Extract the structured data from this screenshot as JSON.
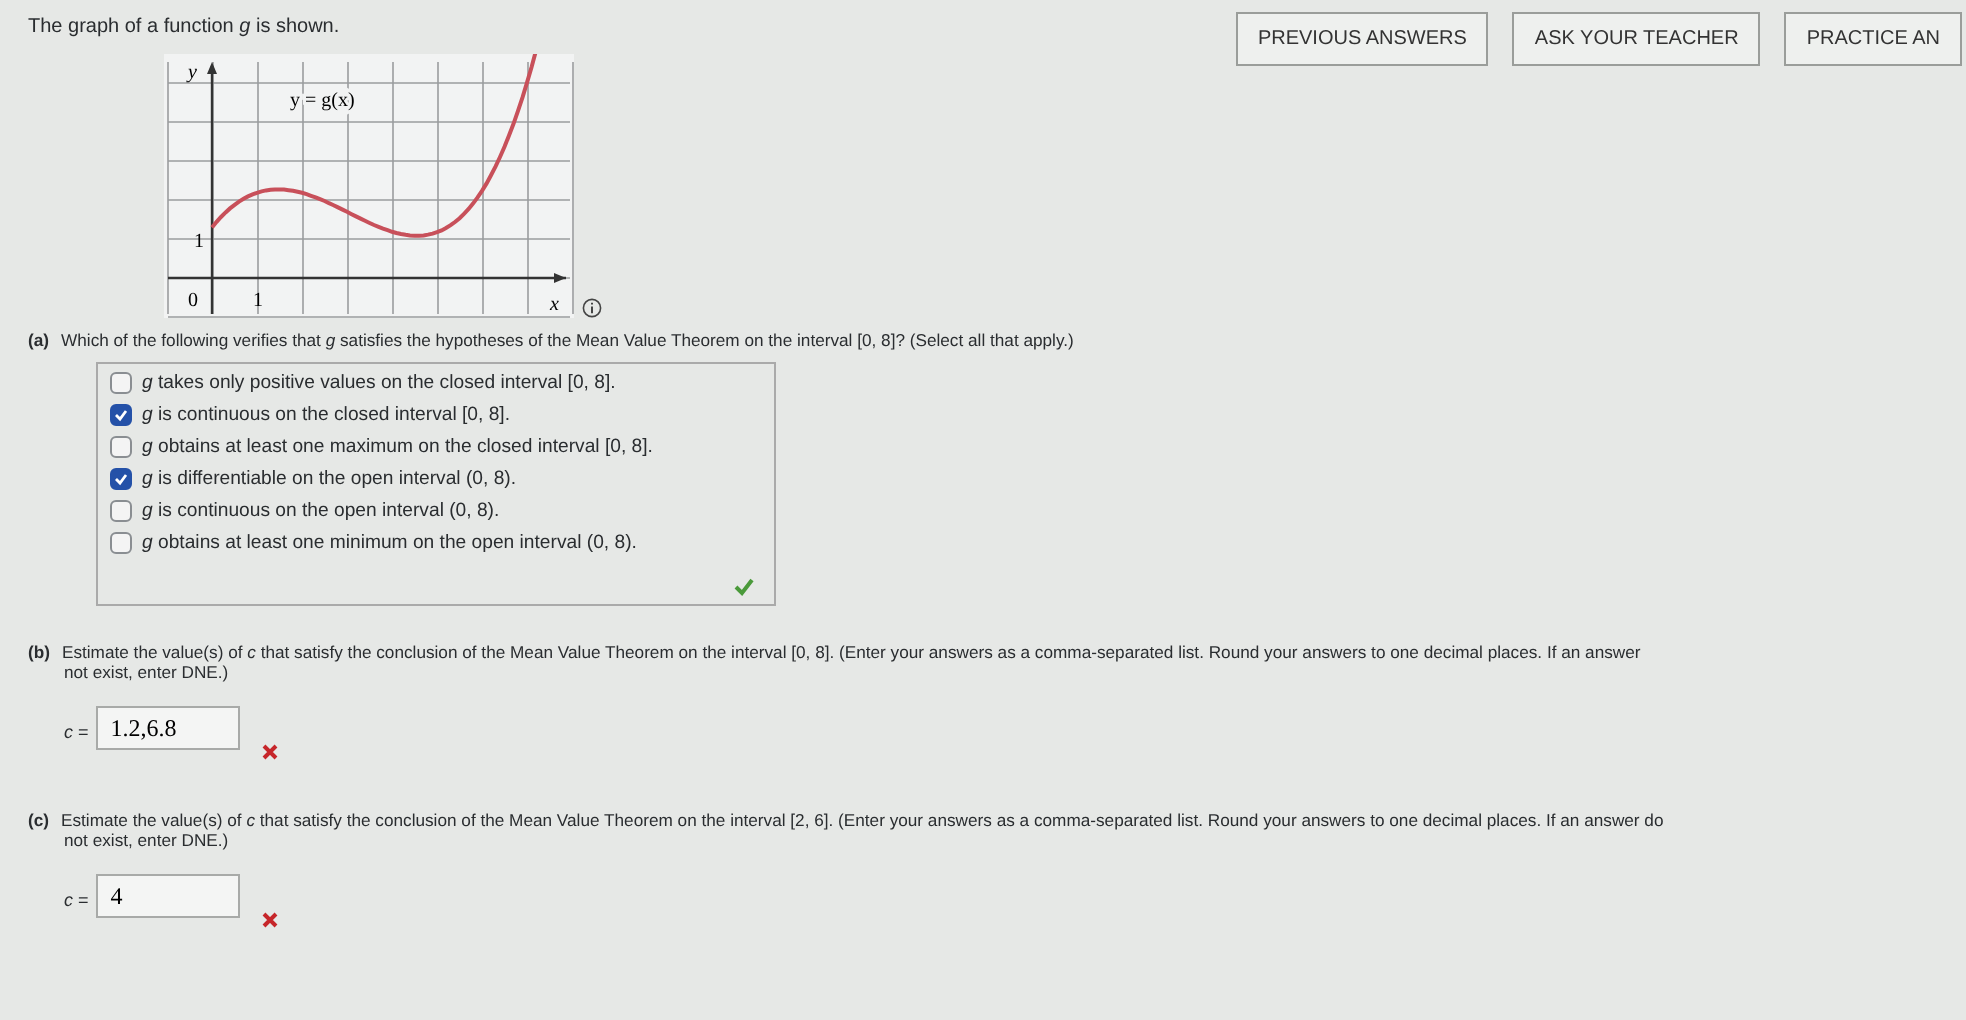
{
  "intro": "The graph of a function *g* is shown.",
  "buttons": [
    "PREVIOUS ANSWERS",
    "ASK YOUR TEACHER",
    "PRACTICE AN"
  ],
  "graph": {
    "y_axis_label": "y",
    "x_axis_label": "x",
    "origin_label": "0",
    "x_tick_label": "1",
    "y_tick_label": "1",
    "curve_label": "y = g(x)"
  },
  "part_a": {
    "letter": "(a)",
    "question": "Which of the following verifies that *g* satisfies the hypotheses of the Mean Value Theorem on the interval [0, 8]? (Select all that apply.)",
    "options": [
      {
        "text": "*g* takes only positive values on the closed interval [0, 8].",
        "checked": false
      },
      {
        "text": "*g* is continuous on the closed interval [0, 8].",
        "checked": true
      },
      {
        "text": "*g* obtains at least one maximum on the closed interval [0, 8].",
        "checked": false
      },
      {
        "text": "*g* is differentiable on the open interval (0, 8).",
        "checked": true
      },
      {
        "text": "*g* is continuous on the open interval (0, 8).",
        "checked": false
      },
      {
        "text": "*g* obtains at least one minimum on the open interval (0, 8).",
        "checked": false
      }
    ],
    "correct": true
  },
  "part_b": {
    "letter": "(b)",
    "prompt_line_1": "Estimate the value(s) of *c* that satisfy the conclusion of the Mean Value Theorem on the interval [0, 8]. (Enter your answers as a comma-separated list. Round your answers to one decimal places. If an answer",
    "prompt_line_2": "not exist, enter DNE.)",
    "answer_label": "*c* =",
    "answer": "1.2,6.8",
    "correct": false
  },
  "part_c": {
    "letter": "(c)",
    "prompt_line_1": "Estimate the value(s) of *c* that satisfy the conclusion of the Mean Value Theorem on the interval [2, 6]. (Enter your answers as a comma-separated list. Round your answers to one decimal places. If an answer do",
    "prompt_line_2": "not exist, enter DNE.)",
    "answer_label": "*c* =",
    "answer": "4",
    "correct": false
  }
}
